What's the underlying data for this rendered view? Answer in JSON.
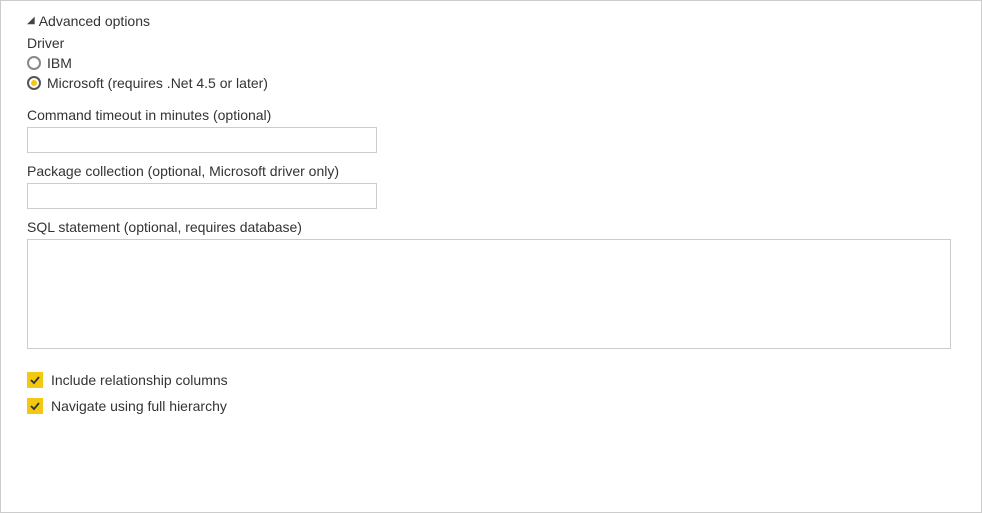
{
  "expander": {
    "title": "Advanced options"
  },
  "driver": {
    "label": "Driver",
    "options": {
      "ibm": "IBM",
      "microsoft": "Microsoft (requires .Net 4.5 or later)"
    },
    "selected": "microsoft"
  },
  "timeout": {
    "label": "Command timeout in minutes (optional)",
    "value": ""
  },
  "packageCollection": {
    "label": "Package collection (optional, Microsoft driver only)",
    "value": ""
  },
  "sqlStatement": {
    "label": "SQL statement (optional, requires database)",
    "value": ""
  },
  "checkboxes": {
    "includeRelationship": {
      "label": "Include relationship columns",
      "checked": true
    },
    "navigateHierarchy": {
      "label": "Navigate using full hierarchy",
      "checked": true
    }
  }
}
